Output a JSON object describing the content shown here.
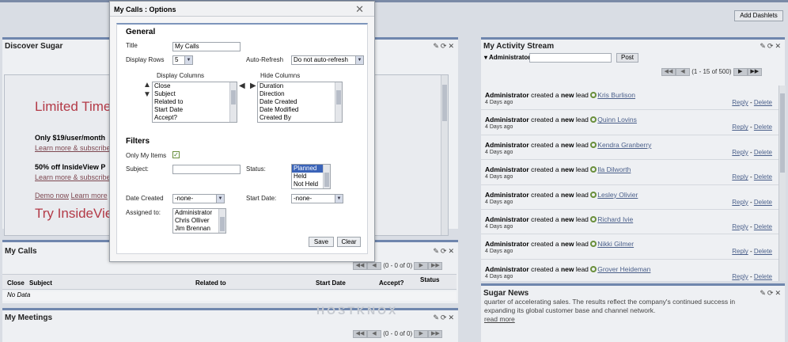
{
  "toolbar": {
    "add_dashlets": "Add Dashlets"
  },
  "discover": {
    "title": "Discover Sugar",
    "promo_title": "Limited Time",
    "promo_price": "Only $19/user/month",
    "promo_link1": "Learn more & subscribe",
    "promo_offer": "50% off InsideView P",
    "promo_link2": "Learn more & subscribe",
    "demo_now": "Demo now",
    "learn_more": "Learn more",
    "try_title": "Try InsideVie"
  },
  "calls": {
    "title": "My Calls",
    "pager_text": "(0 - 0 of 0)",
    "columns": [
      "Close",
      "Subject",
      "Related to",
      "Start Date",
      "Accept?",
      "Status"
    ],
    "no_data": "No Data"
  },
  "meetings": {
    "title": "My Meetings",
    "pager_text": "(0 - 0 of 0)"
  },
  "activity": {
    "title": "My Activity Stream",
    "user": "Administrator",
    "post_label": "Post",
    "pager_text": "(1 - 15 of 500)",
    "verb": "created a",
    "new_word": "new",
    "object_word": "lead",
    "reply": "Reply",
    "delete": "Delete",
    "sep": "-",
    "items": [
      {
        "actor": "Administrator",
        "lead": "Kris Burlison",
        "ago": "4 Days ago"
      },
      {
        "actor": "Administrator",
        "lead": "Quinn Lovins",
        "ago": "4 Days ago"
      },
      {
        "actor": "Administrator",
        "lead": "Kendra Granberry",
        "ago": "4 Days ago"
      },
      {
        "actor": "Administrator",
        "lead": "Ila Dilworth",
        "ago": "4 Days ago"
      },
      {
        "actor": "Administrator",
        "lead": "Lesley Olivier",
        "ago": "4 Days ago"
      },
      {
        "actor": "Administrator",
        "lead": "Richard Ivie",
        "ago": "4 Days ago"
      },
      {
        "actor": "Administrator",
        "lead": "Nikki Gilmer",
        "ago": "4 Days ago"
      },
      {
        "actor": "Administrator",
        "lead": "Grover Heideman",
        "ago": "4 Days ago"
      }
    ]
  },
  "news": {
    "title": "Sugar News",
    "line1": "quarter of accelerating sales. The results reflect the company's continued success in",
    "line2": "expanding its global customer base and channel network.",
    "read_more": "read more"
  },
  "watermark": "HOSTKNOX",
  "modal": {
    "title": "My Calls : Options",
    "close": "✕",
    "general": "General",
    "title_label": "Title",
    "title_value": "My Calls",
    "rows_label": "Display Rows",
    "rows_value": "5",
    "refresh_label": "Auto-Refresh",
    "refresh_value": "Do not auto-refresh",
    "display_cols_label": "Display Columns",
    "hide_cols_label": "Hide Columns",
    "display_cols": [
      "Close",
      "Subject",
      "Related to",
      "Start Date",
      "Accept?"
    ],
    "hide_cols": [
      "Duration",
      "Direction",
      "Date Created",
      "Date Modified",
      "Created By"
    ],
    "filters": "Filters",
    "only_mine_label": "Only My Items",
    "subject_label": "Subject:",
    "status_label": "Status:",
    "status_opts": [
      "Planned",
      "Held",
      "Not Held"
    ],
    "date_created_label": "Date Created",
    "date_created_value": "-none-",
    "start_date_label": "Start Date:",
    "start_date_value": "-none-",
    "assigned_label": "Assigned to:",
    "assigned_opts": [
      "Administrator",
      "Chris Olliver",
      "Jim Brennan"
    ],
    "save": "Save",
    "clear": "Clear"
  }
}
